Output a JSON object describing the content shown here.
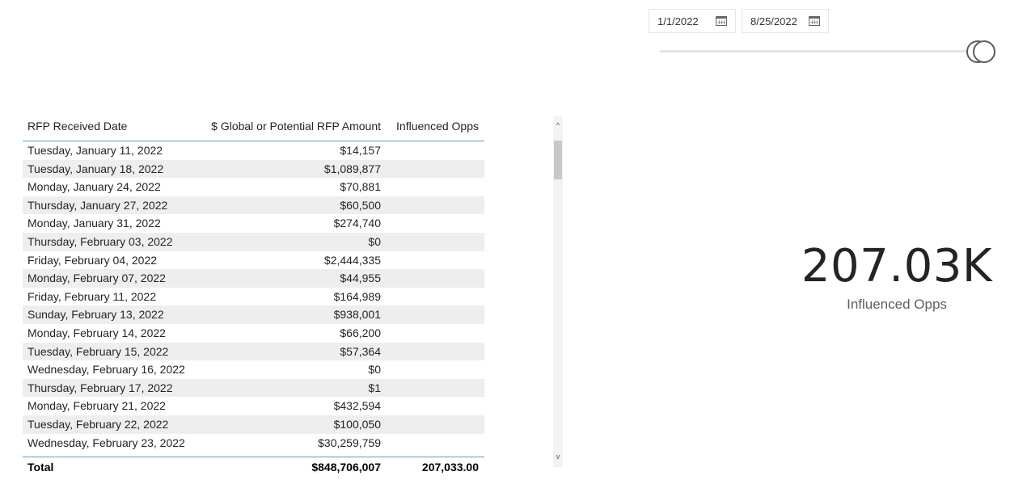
{
  "slicer": {
    "start_date": "1/1/2022",
    "end_date": "8/25/2022",
    "calendar_icon": "calendar-icon"
  },
  "table": {
    "columns": [
      "RFP Received Date",
      "$ Global or Potential RFP Amount",
      "Influenced Opps"
    ],
    "rows": [
      {
        "date": "Tuesday, January 11, 2022",
        "amount": "$14,157",
        "opps": ""
      },
      {
        "date": "Tuesday, January 18, 2022",
        "amount": "$1,089,877",
        "opps": ""
      },
      {
        "date": "Monday, January 24, 2022",
        "amount": "$70,881",
        "opps": ""
      },
      {
        "date": "Thursday, January 27, 2022",
        "amount": "$60,500",
        "opps": ""
      },
      {
        "date": "Monday, January 31, 2022",
        "amount": "$274,740",
        "opps": ""
      },
      {
        "date": "Thursday, February 03, 2022",
        "amount": "$0",
        "opps": ""
      },
      {
        "date": "Friday, February 04, 2022",
        "amount": "$2,444,335",
        "opps": ""
      },
      {
        "date": "Monday, February 07, 2022",
        "amount": "$44,955",
        "opps": ""
      },
      {
        "date": "Friday, February 11, 2022",
        "amount": "$164,989",
        "opps": ""
      },
      {
        "date": "Sunday, February 13, 2022",
        "amount": "$938,001",
        "opps": ""
      },
      {
        "date": "Monday, February 14, 2022",
        "amount": "$66,200",
        "opps": ""
      },
      {
        "date": "Tuesday, February 15, 2022",
        "amount": "$57,364",
        "opps": ""
      },
      {
        "date": "Wednesday, February 16, 2022",
        "amount": "$0",
        "opps": ""
      },
      {
        "date": "Thursday, February 17, 2022",
        "amount": "$1",
        "opps": ""
      },
      {
        "date": "Monday, February 21, 2022",
        "amount": "$432,594",
        "opps": ""
      },
      {
        "date": "Tuesday, February 22, 2022",
        "amount": "$100,050",
        "opps": ""
      },
      {
        "date": "Wednesday, February 23, 2022",
        "amount": "$30,259,759",
        "opps": ""
      }
    ],
    "total": {
      "label": "Total",
      "amount": "$848,706,007",
      "opps": "207,033.00"
    }
  },
  "scrollbar": {
    "up_icon": "chevron-up-icon",
    "down_icon": "chevron-down-icon",
    "up_glyph": "^",
    "down_glyph": "v"
  },
  "kpi": {
    "value": "207.03K",
    "label": "Influenced Opps"
  }
}
